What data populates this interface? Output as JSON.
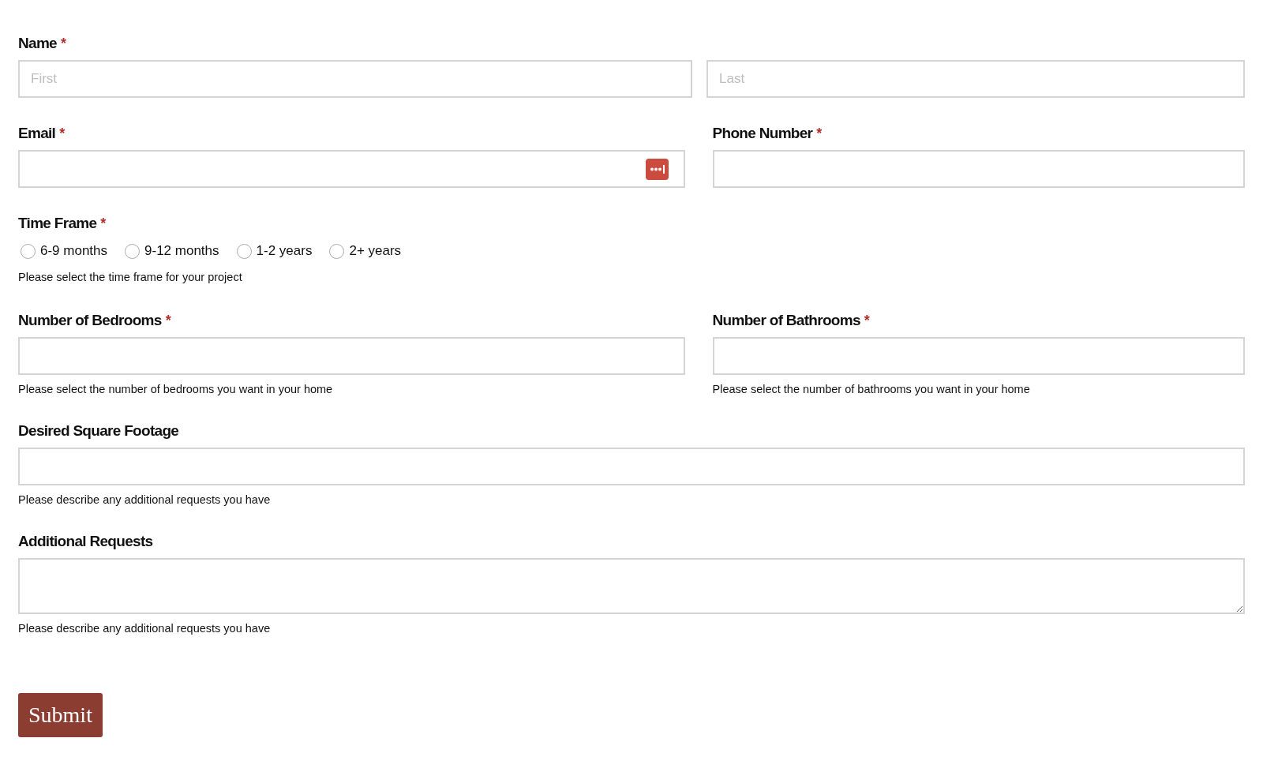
{
  "form": {
    "rows": [
      {
        "kind": "name",
        "label": "Name",
        "mark": "*",
        "inputs": [
          {
            "placeholder": "First"
          },
          {
            "placeholder": "Last"
          }
        ]
      },
      {
        "kind": "pair",
        "fields": [
          {
            "label": "Email",
            "mark": "*",
            "autofill_icon": true
          },
          {
            "label": "Phone Number",
            "mark": "*"
          }
        ]
      },
      {
        "kind": "radio",
        "label": "Time Frame",
        "mark": "*",
        "options": [
          {
            "label": "6-9 months",
            "selected": false
          },
          {
            "label": "9-12 months",
            "selected": false
          },
          {
            "label": "1-2 years",
            "selected": false
          },
          {
            "label": "2+ years",
            "selected": false
          }
        ],
        "help": "Please select the time frame for your project"
      },
      {
        "kind": "pair",
        "fields": [
          {
            "label": "Number of Bedrooms",
            "mark": "*",
            "help": "Please select the number of bedrooms you want in your home"
          },
          {
            "label": "Number of Bathrooms",
            "mark": "*",
            "help": "Please select the number of bathrooms you want in your home"
          }
        ]
      },
      {
        "kind": "text",
        "label": "Desired Square Footage",
        "help": "Please describe any additional requests you have"
      },
      {
        "kind": "textarea",
        "label": "Additional Requests",
        "help": "Please describe any additional requests you have"
      }
    ]
  },
  "submit": "Submit"
}
